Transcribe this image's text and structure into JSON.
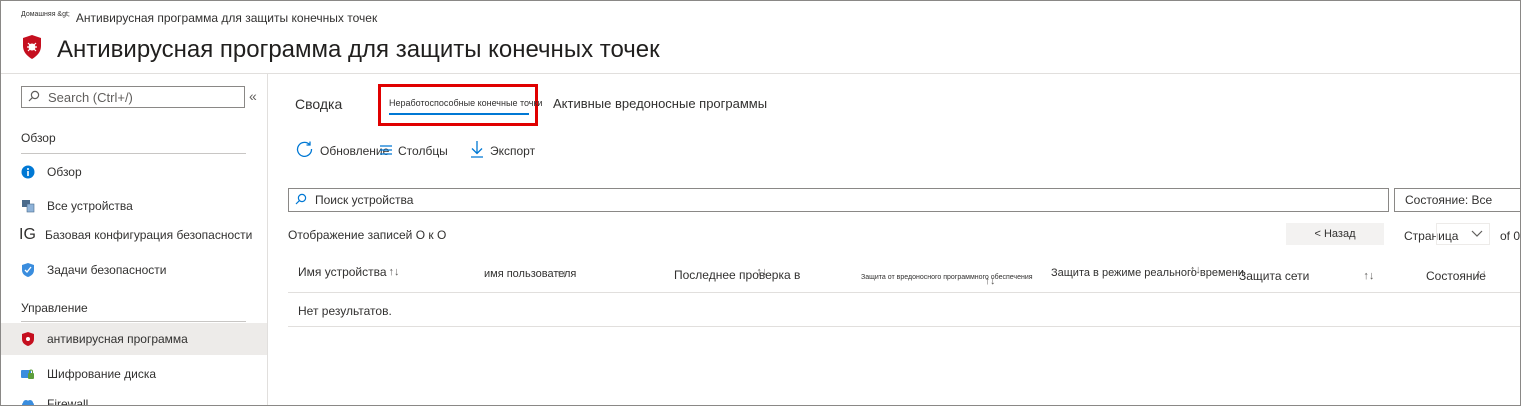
{
  "breadcrumb": {
    "home": "Домашняя &gt;",
    "current": "Антивирусная программа для защиты конечных точек"
  },
  "page": {
    "title": "Антивирусная программа для защиты конечных точек"
  },
  "sidebar": {
    "search_placeholder": "Search (Ctrl+/)",
    "section_overview": "Обзор",
    "section_manage": "Управление",
    "items": [
      {
        "label": "Обзор",
        "icon": "info-icon"
      },
      {
        "label": "Все устройства",
        "icon": "devices-icon"
      },
      {
        "label": "Базовая конфигурация безопасности",
        "icon": "ig-icon",
        "icon_text": "IG"
      },
      {
        "label": "Задачи безопасности",
        "icon": "shield-task-icon"
      },
      {
        "label": "антивирусная программа",
        "icon": "antivirus-shield-icon"
      },
      {
        "label": "Шифрование диска",
        "icon": "disk-encryption-icon"
      },
      {
        "label": "Firewall",
        "icon": "firewall-icon"
      }
    ]
  },
  "tabs": [
    {
      "label": "Сводка"
    },
    {
      "label": "Неработоспособные конечные точки"
    },
    {
      "label": "Активные вредоносные программы"
    }
  ],
  "toolbar": {
    "refresh": "Обновление",
    "columns": "Столбцы",
    "export": "Экспорт"
  },
  "filters": {
    "device_search": "Поиск устройства",
    "state": "Состояние: Все"
  },
  "pagination": {
    "records": "Отображение записей O к O",
    "back": "< Назад",
    "page_label": "Страница",
    "of": "of 0"
  },
  "table": {
    "columns": [
      "Имя устройства",
      "имя пользователя",
      "Последнее проверка в",
      "Защита от вредоносного программного обеспечения",
      "Защита в режиме реального времени",
      "Защита сети",
      "Состояние"
    ],
    "empty": "Нет результатов."
  },
  "colors": {
    "accent": "#0078d4",
    "highlight": "#e00000",
    "brand_red": "#c50f1f"
  }
}
